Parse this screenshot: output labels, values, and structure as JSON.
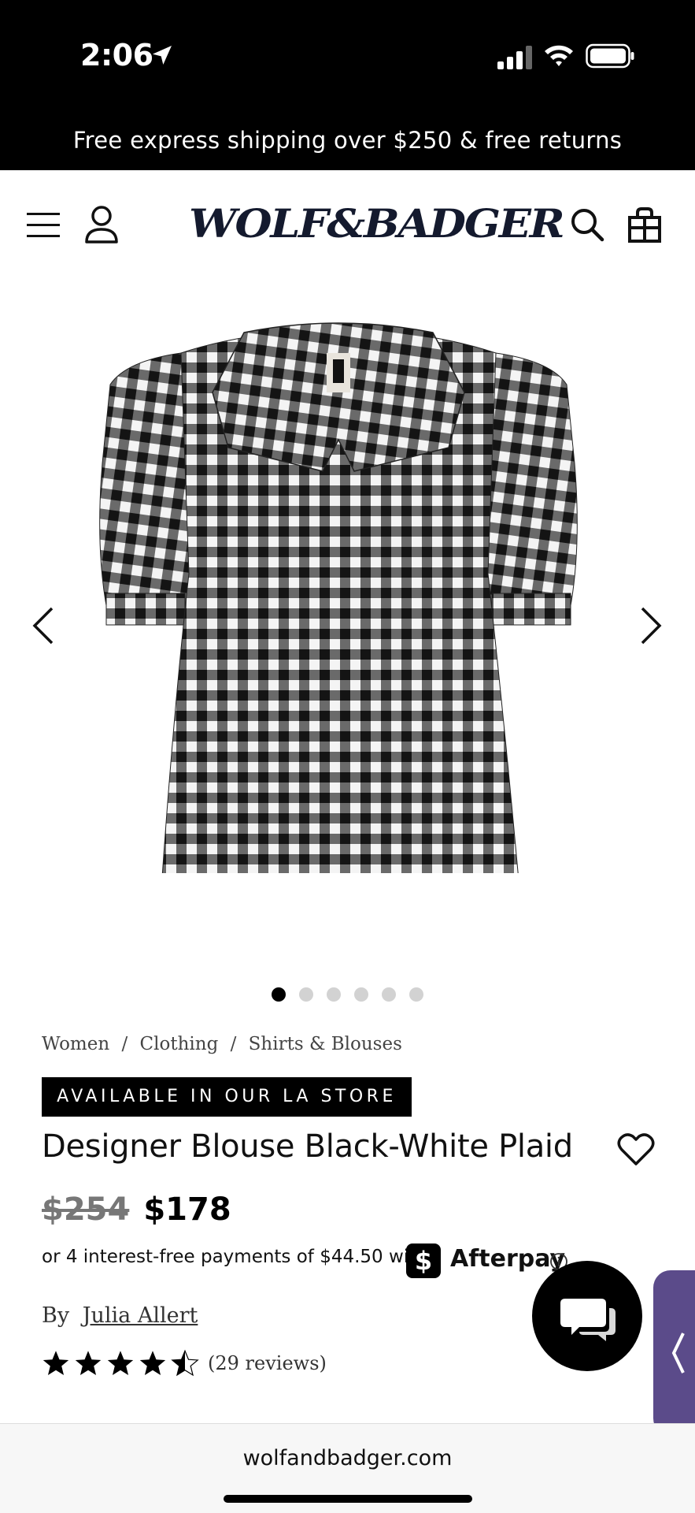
{
  "status_bar": {
    "time": "2:06"
  },
  "promo": {
    "text": "Free express shipping over $250 & free returns"
  },
  "header": {
    "logo": "WOLF&BADGER"
  },
  "gallery": {
    "image_count": 6,
    "active_index": 0
  },
  "breadcrumb": [
    "Women",
    "/",
    "Clothing",
    "/",
    "Shirts & Blouses"
  ],
  "product": {
    "badge": "AVAILABLE IN OUR LA STORE",
    "title": "Designer Blouse Black-White Plaid",
    "price_old": "$254",
    "price_new": "$178",
    "installment_text": "or 4 interest-free payments of $44.50 with",
    "afterpay_mark": "$",
    "afterpay_name": "Afterpay",
    "by_label": "By",
    "designer": "Julia Allert",
    "rating": 4.5,
    "reviews": "(29 reviews)"
  },
  "browser": {
    "url": "wolfandbadger.com"
  },
  "colors": {
    "black": "#000000",
    "side_tab": "#5b4b8a"
  }
}
